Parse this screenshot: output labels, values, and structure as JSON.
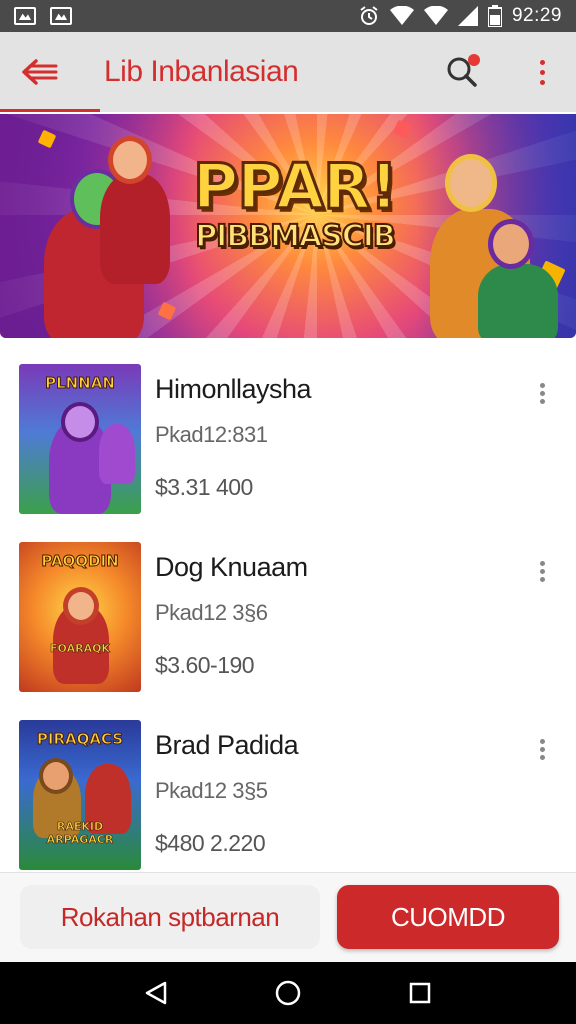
{
  "status_bar": {
    "time": "92:29",
    "icons": [
      "gallery-notification-icon",
      "gallery-notification-icon",
      "alarm-icon",
      "wifi-icon",
      "wifi-icon",
      "signal-icon",
      "battery-icon"
    ]
  },
  "app_bar": {
    "title_main": "Lib Inbanlasian",
    "back_icon": "back-arrow-icon",
    "search_icon": "search-icon",
    "more_icon": "more-vert-icon",
    "accent": "#d32f2f"
  },
  "banner": {
    "title_line1": "PPAR!",
    "title_line2": "PIBBMASCIB"
  },
  "items": [
    {
      "title": "Himonllaysha",
      "id": "Pkad12:831",
      "price": "$3.31 400",
      "thumb_title": "PLNNAN",
      "thumb_sub": ""
    },
    {
      "title": "Dog Knuaam",
      "id": "Pkad12 3§6",
      "price": "$3.60-190",
      "thumb_title": "PAQQDIN",
      "thumb_sub": "FOARAQK"
    },
    {
      "title": "Brad Padida",
      "id": "Pkad12 3§5",
      "price": "$480 2.220",
      "thumb_title": "PIRAQACS",
      "thumb_sub": "RAEKID ARPAGACR"
    }
  ],
  "actions": {
    "secondary_label": "Rokahan sptbarnan",
    "primary_label": "CUOMDD",
    "primary_color": "#cc2a2a"
  },
  "nav_bar": {
    "icons": [
      "nav-back-icon",
      "nav-home-icon",
      "nav-recents-icon"
    ]
  }
}
